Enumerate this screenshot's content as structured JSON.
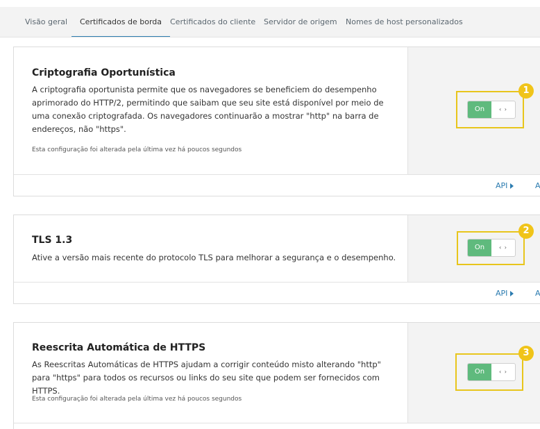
{
  "tabs": [
    {
      "label": "Visão geral",
      "active": false
    },
    {
      "label": "Certificados de borda",
      "active": true
    },
    {
      "label": "Certificados do cliente",
      "active": false
    },
    {
      "label": "Servidor de origem",
      "active": false
    },
    {
      "label": "Nomes de host personalizados",
      "active": false
    }
  ],
  "cards": [
    {
      "title": "Criptografia Oportunística",
      "description": "A criptografia oportunista permite que os navegadores se beneficiem do desempenho aprimorado do HTTP/2, permitindo que saibam que seu site está disponível por meio de uma conexão criptografada. Os navegadores continuarão a mostrar \"http\" na barra de endereços, não \"https\".",
      "note": "Esta configuração foi alterada pela última vez há poucos segundos",
      "toggle": {
        "state": "On",
        "arrows": "‹ ›"
      },
      "badge": "1",
      "footer": {
        "api": "API",
        "more": "A"
      }
    },
    {
      "title": "TLS 1.3",
      "description": "Ative a versão mais recente do protocolo TLS para melhorar a segurança e o desempenho.",
      "toggle": {
        "state": "On",
        "arrows": "‹ ›"
      },
      "badge": "2",
      "footer": {
        "api": "API",
        "more": "A"
      }
    },
    {
      "title": "Reescrita Automática de HTTPS",
      "description": "As Reescritas Automáticas de HTTPS ajudam a corrigir conteúdo misto alterando \"http\" para \"https\" para todos os recursos ou links do seu site que podem ser fornecidos com HTTPS.",
      "note": "Esta configuração foi alterada pela última vez há poucos segundos",
      "toggle": {
        "state": "On",
        "arrows": "‹ ›"
      },
      "badge": "3"
    }
  ],
  "colors": {
    "toggle_on": "#5fba7d",
    "highlight": "#e8c51b",
    "badge": "#f0c419",
    "link": "#2c7cb0",
    "active_tab": "#2c7cb0"
  }
}
